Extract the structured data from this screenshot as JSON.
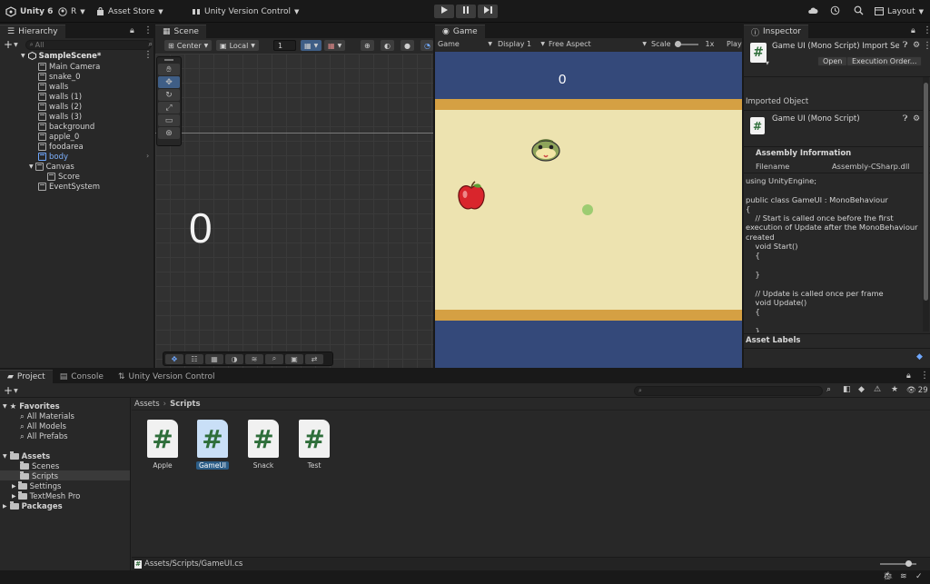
{
  "topbar": {
    "app_name": "Unity 6",
    "account_initial": "R",
    "asset_store": "Asset Store",
    "version_control": "Unity Version Control",
    "layout": "Layout"
  },
  "hierarchy": {
    "tab": "Hierarchy",
    "search_placeholder": "All",
    "scene_name": "SampleScene*",
    "items": [
      {
        "label": "Main Camera"
      },
      {
        "label": "snake_0"
      },
      {
        "label": "walls"
      },
      {
        "label": "walls (1)"
      },
      {
        "label": "walls (2)"
      },
      {
        "label": "walls (3)"
      },
      {
        "label": "background"
      },
      {
        "label": "apple_0"
      },
      {
        "label": "foodarea"
      },
      {
        "label": "body"
      },
      {
        "label": "Canvas"
      },
      {
        "label": "Score"
      },
      {
        "label": "EventSystem"
      }
    ]
  },
  "scene": {
    "tab": "Scene",
    "pivot": "Center",
    "space": "Local",
    "grid_value": "1",
    "score_text": "0"
  },
  "game": {
    "tab": "Game",
    "mode": "Game",
    "display": "Display 1",
    "aspect": "Free Aspect",
    "scale_label": "Scale",
    "scale_value": "1x",
    "play_label": "Play",
    "score": "0"
  },
  "inspector": {
    "tab": "Inspector",
    "title": "Game UI (Mono Script) Import Se",
    "open_button": "Open",
    "exec_order_button": "Execution Order...",
    "imported_object": "Imported Object",
    "object_name": "Game UI (Mono Script)",
    "assembly_info": "Assembly Information",
    "filename_label": "Filename",
    "filename_value": "Assembly-CSharp.dll",
    "code": "using UnityEngine;\n\npublic class GameUI : MonoBehaviour\n{\n    // Start is called once before the first\nexecution of Update after the MonoBehaviour is\ncreated\n    void Start()\n    {\n\n    }\n\n    // Update is called once per frame\n    void Update()\n    {\n\n    }",
    "asset_labels": "Asset Labels"
  },
  "project": {
    "tabs": [
      "Project",
      "Console",
      "Unity Version Control"
    ],
    "breadcrumb_root": "Assets",
    "breadcrumb_current": "Scripts",
    "count": "29",
    "favorites": "Favorites",
    "favorite_items": [
      "All Materials",
      "All Models",
      "All Prefabs"
    ],
    "assets": "Assets",
    "asset_folders": [
      "Scenes",
      "Scripts",
      "Settings",
      "TextMesh Pro"
    ],
    "packages": "Packages",
    "files": [
      "Apple",
      "GameUI",
      "Snack",
      "Test"
    ],
    "path": "Assets/Scripts/GameUI.cs"
  },
  "colors": {
    "selection": "#2c5d87",
    "game_sky": "#34497a",
    "game_wall": "#d5a043",
    "game_field": "#ede3b0"
  }
}
